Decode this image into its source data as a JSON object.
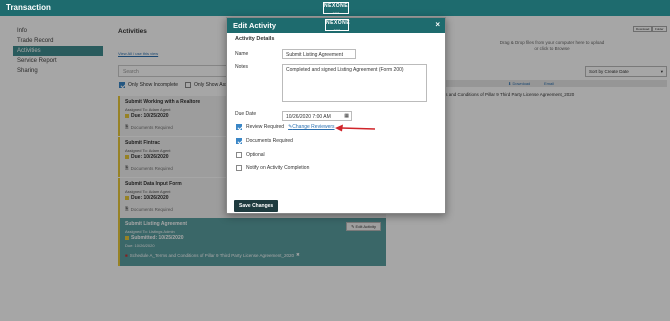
{
  "topbar": {
    "title": "Transaction",
    "logo": "NEXONE",
    "logo_sub": "aaaa"
  },
  "sidebar": {
    "items": [
      {
        "label": "Info"
      },
      {
        "label": "Trade Record"
      },
      {
        "label": "Activities"
      },
      {
        "label": "Service Report"
      },
      {
        "label": "Sharing"
      }
    ]
  },
  "activities": {
    "title": "Activities",
    "view_all": "View All / use this view",
    "search_placeholder": "Search",
    "only_incomplete": "Only Show Incomplete",
    "only_show_assigned": "Only Show Ass",
    "cards": [
      {
        "title": "Submit Working with a Realtore",
        "assigned": "Assigned To:  Adam Agent",
        "due": "Due: 10/25/2020",
        "req": "Documents Required"
      },
      {
        "title": "Submit Fintrac",
        "assigned": "Assigned To:  Adam Agent",
        "due": "Due: 10/26/2020",
        "req": "Documents Required"
      },
      {
        "title": "Submit Data Input Form",
        "assigned": "Assigned To:  Adam Agent",
        "due": "Due: 10/26/2020",
        "req": "Documents Required"
      },
      {
        "title": "Submit Listing Agreement",
        "assigned": "Assigned To: Listings Admin",
        "due": "Submitted: 10/25/2020",
        "due2": "Due: 10/26/2020",
        "req": "Schedule A_Terms and Conditions of Pillar 9 Third Party License Agreement_2020",
        "edit": "Edit Activity"
      }
    ]
  },
  "documents": {
    "drop_text": "Drag & Drop files from your computer here to upload",
    "drop_text2": "or click to Browse",
    "btn1": "Download",
    "btn2": "Folder",
    "sort": "Sort by Create Date",
    "download": "Download",
    "email": "Email",
    "file": "rms and Conditions of Pillar 9 Third Party License Agreement_2020"
  },
  "modal": {
    "title": "Edit Activity",
    "logo": "NEXONE",
    "logo_sub": "aaaa",
    "close": "×",
    "section": "Activity Details",
    "name_label": "Name",
    "name_value": "Submit Listing Agreement",
    "notes_label": "Notes",
    "notes_value": "Completed and signed Listing Agreement (Form 200)",
    "due_label": "Due Date",
    "due_value": "10/26/2020 7:00 AM",
    "review_required": "Review Required",
    "change_reviewers": "Change Reviewers",
    "documents_required": "Documents Required",
    "optional": "Optional",
    "notify": "Notify on Activity Completion",
    "save": "Save Changes"
  },
  "colors": {
    "primary": "#1e6b6e",
    "accent": "#3f8c8f",
    "arrow": "#d0242a",
    "flag": "#e8c83a"
  }
}
